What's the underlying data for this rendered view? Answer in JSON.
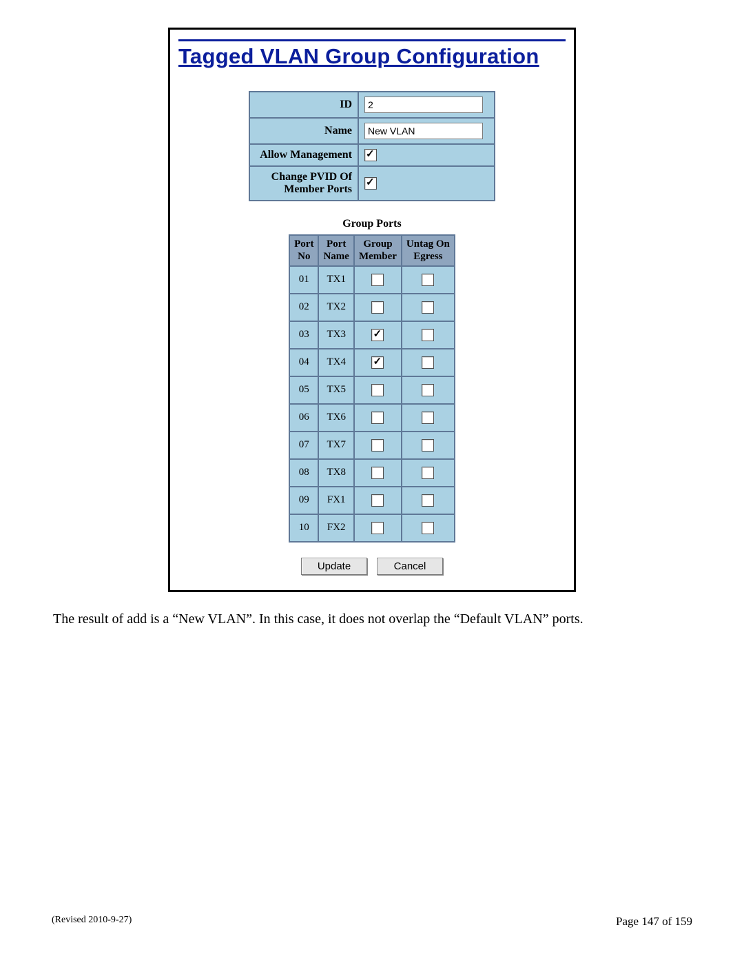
{
  "title": "Tagged VLAN Group Configuration",
  "top_form": {
    "id_label": "ID",
    "id_value": "2",
    "name_label": "Name",
    "name_value": "New VLAN",
    "allow_mgmt_label": "Allow Management",
    "allow_mgmt_checked": true,
    "change_pvid_label_l1": "Change PVID Of",
    "change_pvid_label_l2": "Member Ports",
    "change_pvid_checked": true
  },
  "group_ports_heading": "Group Ports",
  "ports_headers": {
    "port_no_l1": "Port",
    "port_no_l2": "No",
    "port_name_l1": "Port",
    "port_name_l2": "Name",
    "group_member_l1": "Group",
    "group_member_l2": "Member",
    "untag_l1": "Untag On",
    "untag_l2": "Egress"
  },
  "ports": [
    {
      "no": "01",
      "name": "TX1",
      "member": false,
      "untag": false
    },
    {
      "no": "02",
      "name": "TX2",
      "member": false,
      "untag": false
    },
    {
      "no": "03",
      "name": "TX3",
      "member": true,
      "untag": false
    },
    {
      "no": "04",
      "name": "TX4",
      "member": true,
      "untag": false
    },
    {
      "no": "05",
      "name": "TX5",
      "member": false,
      "untag": false
    },
    {
      "no": "06",
      "name": "TX6",
      "member": false,
      "untag": false
    },
    {
      "no": "07",
      "name": "TX7",
      "member": false,
      "untag": false
    },
    {
      "no": "08",
      "name": "TX8",
      "member": false,
      "untag": false
    },
    {
      "no": "09",
      "name": "FX1",
      "member": false,
      "untag": false
    },
    {
      "no": "10",
      "name": "FX2",
      "member": false,
      "untag": false
    }
  ],
  "buttons": {
    "update": "Update",
    "cancel": "Cancel"
  },
  "caption": "The result of add is a “New VLAN”. In this case, it does not overlap the “Default VLAN” ports.",
  "footer": {
    "revised": "(Revised 2010-9-27)",
    "page": "Page 147 of 159"
  }
}
